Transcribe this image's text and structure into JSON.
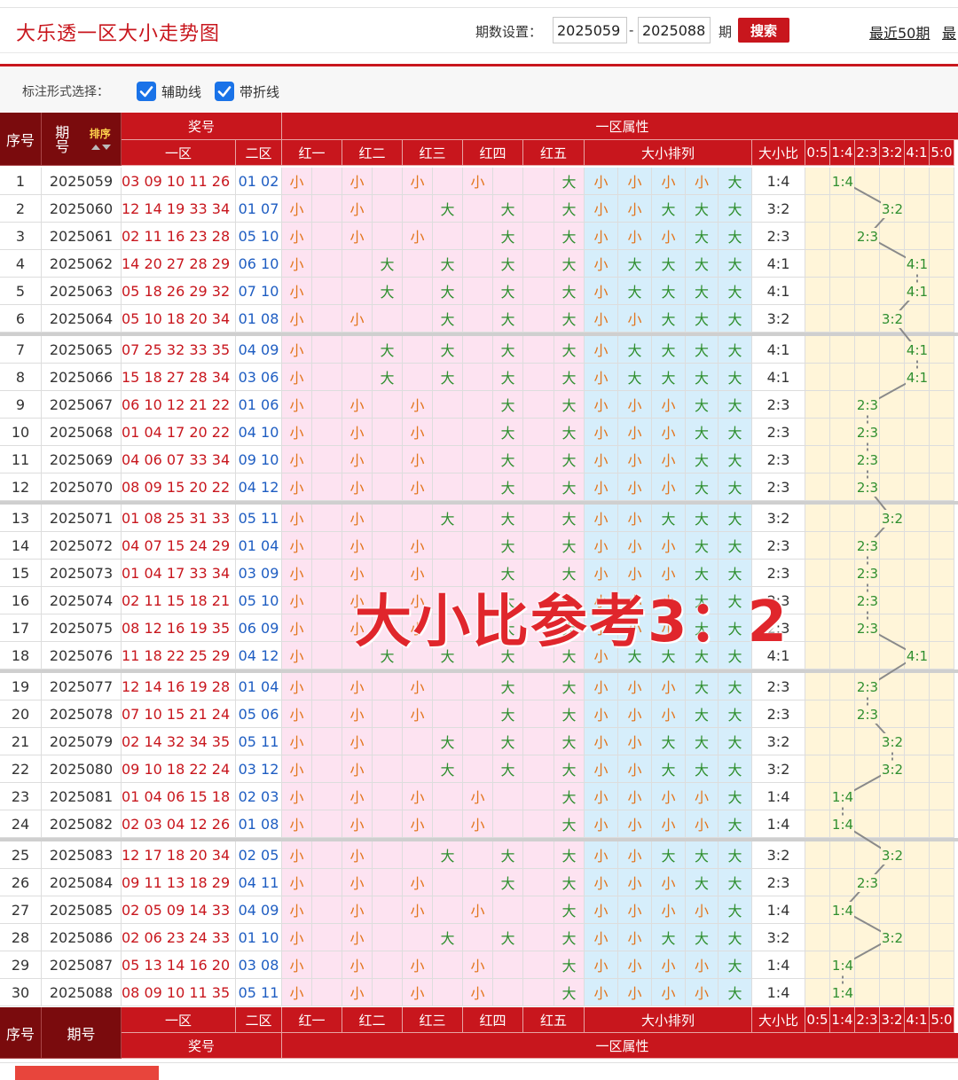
{
  "header": {
    "title": "大乐透一区大小走势图",
    "period_label": "期数设置：",
    "period_from": "2025059",
    "period_to": "2025088",
    "dash": "-",
    "period_unit": "期",
    "search_label": "搜索",
    "recent_50": "最近50期",
    "recent_more": "最"
  },
  "options": {
    "label": "标注形式选择：",
    "aux_line": "辅助线",
    "fold_line": "带折线"
  },
  "table": {
    "head": {
      "seq": "序号",
      "period": "期号",
      "sort": "排序",
      "prize": "奖号",
      "attr_group": "一区属性",
      "zone1": "一区",
      "zone2": "二区",
      "reds": [
        "红一",
        "红二",
        "红三",
        "红四",
        "红五"
      ],
      "arrangement": "大小排列",
      "ratio": "大小比",
      "ratios": [
        "0:5",
        "1:4",
        "2:3",
        "3:2",
        "4:1",
        "5:0"
      ]
    },
    "big_label": "大",
    "small_label": "小",
    "rows": [
      {
        "seq": "1",
        "period": "2025059",
        "zone1": "03 09 10 11 26",
        "zone2": "01 02",
        "pattern": "SSSSB",
        "ratio": "1:4"
      },
      {
        "seq": "2",
        "period": "2025060",
        "zone1": "12 14 19 33 34",
        "zone2": "01 07",
        "pattern": "SSBBB",
        "ratio": "3:2"
      },
      {
        "seq": "3",
        "period": "2025061",
        "zone1": "02 11 16 23 28",
        "zone2": "05 10",
        "pattern": "SSSBB",
        "ratio": "2:3"
      },
      {
        "seq": "4",
        "period": "2025062",
        "zone1": "14 20 27 28 29",
        "zone2": "06 10",
        "pattern": "SBBBB",
        "ratio": "4:1"
      },
      {
        "seq": "5",
        "period": "2025063",
        "zone1": "05 18 26 29 32",
        "zone2": "07 10",
        "pattern": "SBBBB",
        "ratio": "4:1"
      },
      {
        "seq": "6",
        "period": "2025064",
        "zone1": "05 10 18 20 34",
        "zone2": "01 08",
        "pattern": "SSBBB",
        "ratio": "3:2"
      },
      {
        "seq": "7",
        "period": "2025065",
        "zone1": "07 25 32 33 35",
        "zone2": "04 09",
        "pattern": "SBBBB",
        "ratio": "4:1"
      },
      {
        "seq": "8",
        "period": "2025066",
        "zone1": "15 18 27 28 34",
        "zone2": "03 06",
        "pattern": "SBBBB",
        "ratio": "4:1"
      },
      {
        "seq": "9",
        "period": "2025067",
        "zone1": "06 10 12 21 22",
        "zone2": "01 06",
        "pattern": "SSSBB",
        "ratio": "2:3"
      },
      {
        "seq": "10",
        "period": "2025068",
        "zone1": "01 04 17 20 22",
        "zone2": "04 10",
        "pattern": "SSSBB",
        "ratio": "2:3"
      },
      {
        "seq": "11",
        "period": "2025069",
        "zone1": "04 06 07 33 34",
        "zone2": "09 10",
        "pattern": "SSSBB",
        "ratio": "2:3"
      },
      {
        "seq": "12",
        "period": "2025070",
        "zone1": "08 09 15 20 22",
        "zone2": "04 12",
        "pattern": "SSSBB",
        "ratio": "2:3"
      },
      {
        "seq": "13",
        "period": "2025071",
        "zone1": "01 08 25 31 33",
        "zone2": "05 11",
        "pattern": "SSBBB",
        "ratio": "3:2"
      },
      {
        "seq": "14",
        "period": "2025072",
        "zone1": "04 07 15 24 29",
        "zone2": "01 04",
        "pattern": "SSSBB",
        "ratio": "2:3"
      },
      {
        "seq": "15",
        "period": "2025073",
        "zone1": "01 04 17 33 34",
        "zone2": "03 09",
        "pattern": "SSSBB",
        "ratio": "2:3"
      },
      {
        "seq": "16",
        "period": "2025074",
        "zone1": "02 11 15 18 21",
        "zone2": "05 10",
        "pattern": "SSSBB",
        "ratio": "2:3"
      },
      {
        "seq": "17",
        "period": "2025075",
        "zone1": "08 12 16 19 35",
        "zone2": "06 09",
        "pattern": "SSSBB",
        "ratio": "2:3"
      },
      {
        "seq": "18",
        "period": "2025076",
        "zone1": "11 18 22 25 29",
        "zone2": "04 12",
        "pattern": "SBBBB",
        "ratio": "4:1"
      },
      {
        "seq": "19",
        "period": "2025077",
        "zone1": "12 14 16 19 28",
        "zone2": "01 04",
        "pattern": "SSSBB",
        "ratio": "2:3"
      },
      {
        "seq": "20",
        "period": "2025078",
        "zone1": "07 10 15 21 24",
        "zone2": "05 06",
        "pattern": "SSSBB",
        "ratio": "2:3"
      },
      {
        "seq": "21",
        "period": "2025079",
        "zone1": "02 14 32 34 35",
        "zone2": "05 11",
        "pattern": "SSBBB",
        "ratio": "3:2"
      },
      {
        "seq": "22",
        "period": "2025080",
        "zone1": "09 10 18 22 24",
        "zone2": "03 12",
        "pattern": "SSBBB",
        "ratio": "3:2"
      },
      {
        "seq": "23",
        "period": "2025081",
        "zone1": "01 04 06 15 18",
        "zone2": "02 03",
        "pattern": "SSSSB",
        "ratio": "1:4"
      },
      {
        "seq": "24",
        "period": "2025082",
        "zone1": "02 03 04 12 26",
        "zone2": "01 08",
        "pattern": "SSSSB",
        "ratio": "1:4"
      },
      {
        "seq": "25",
        "period": "2025083",
        "zone1": "12 17 18 20 34",
        "zone2": "02 05",
        "pattern": "SSBBB",
        "ratio": "3:2"
      },
      {
        "seq": "26",
        "period": "2025084",
        "zone1": "09 11 13 18 29",
        "zone2": "04 11",
        "pattern": "SSSBB",
        "ratio": "2:3"
      },
      {
        "seq": "27",
        "period": "2025085",
        "zone1": "02 05 09 14 33",
        "zone2": "04 09",
        "pattern": "SSSSB",
        "ratio": "1:4"
      },
      {
        "seq": "28",
        "period": "2025086",
        "zone1": "02 06 23 24 33",
        "zone2": "01 10",
        "pattern": "SSBBB",
        "ratio": "3:2"
      },
      {
        "seq": "29",
        "period": "2025087",
        "zone1": "05 13 14 16 20",
        "zone2": "03 08",
        "pattern": "SSSSB",
        "ratio": "1:4"
      },
      {
        "seq": "30",
        "period": "2025088",
        "zone1": "08 09 10 11 35",
        "zone2": "05 11",
        "pattern": "SSSSB",
        "ratio": "1:4"
      }
    ]
  },
  "watermark": "大小比参考3：2",
  "colors": {
    "brand_red": "#c8161d",
    "header_dark": "#7a0b0d",
    "big": "#2f8f2f",
    "small": "#e2751d",
    "red_zone_bg": "#fde3f1",
    "pattern_bg": "#d6eefb",
    "ratio_bg": "#fff5d9",
    "fold_line": "#8a8a8a"
  }
}
